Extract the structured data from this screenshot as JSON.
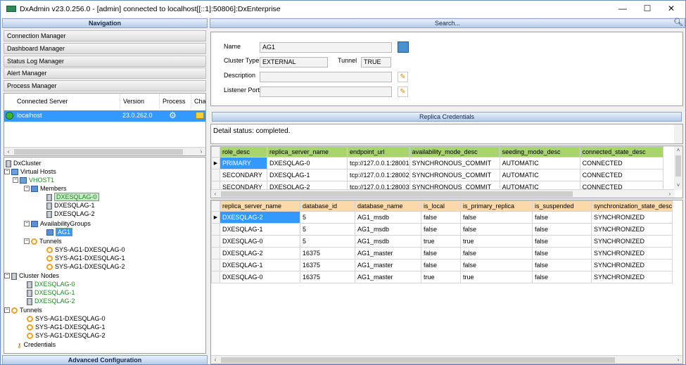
{
  "window": {
    "title": "DxAdmin v23.0.256.0 - [admin] connected to localhost[[::1]:50806]:DxEnterprise",
    "minimize": "—",
    "maximize": "☐",
    "close": "✕"
  },
  "navigation": {
    "header": "Navigation",
    "items": [
      "Connection Manager",
      "Dashboard Manager",
      "Status Log Manager",
      "Alert Manager",
      "Process Manager"
    ],
    "footer": "Advanced Configuration"
  },
  "servers": {
    "columns": [
      "Connected Server",
      "Version",
      "Process",
      "Chat"
    ],
    "rows": [
      {
        "server": "localhost",
        "version": "23.0.262.0"
      }
    ]
  },
  "tree": {
    "root": "DxCluster",
    "virtual_hosts": "Virtual Hosts",
    "vhost": "VHOST1",
    "members": "Members",
    "member_items": [
      "DXESQLAG-0",
      "DXESQLAG-1",
      "DXESQLAG-2"
    ],
    "availability_groups": "AvailabilityGroups",
    "ag": "AG1",
    "tunnels": "Tunnels",
    "tunnel_items": [
      "SYS-AG1-DXESQLAG-0",
      "SYS-AG1-DXESQLAG-1",
      "SYS-AG1-DXESQLAG-2"
    ],
    "cluster_nodes": "Cluster Nodes",
    "node_items": [
      "DXESQLAG-0",
      "DXESQLAG-1",
      "DXESQLAG-2"
    ],
    "tunnels2": "Tunnels",
    "tunnel2_items": [
      "SYS-AG1-DXESQLAG-0",
      "SYS-AG1-DXESQLAG-1",
      "SYS-AG1-DXESQLAG-2"
    ],
    "credentials": "Credentials"
  },
  "search": {
    "label": "Search..."
  },
  "details": {
    "name_label": "Name",
    "name_value": "AG1",
    "cluster_type_label": "Cluster Type",
    "cluster_type_value": "EXTERNAL",
    "tunnel_label": "Tunnel",
    "tunnel_value": "TRUE",
    "description_label": "Description",
    "description_value": "",
    "listener_label": "Listener Port",
    "listener_value": ""
  },
  "replica": {
    "header": "Replica Credentials",
    "status": "Detail status: completed."
  },
  "grid1": {
    "columns": [
      "role_desc",
      "replica_server_name",
      "endpoint_url",
      "availability_mode_desc",
      "seeding_mode_desc",
      "connected_state_desc"
    ],
    "rows": [
      [
        "PRIMARY",
        "DXESQLAG-0",
        "tcp://127.0.0.1:28001",
        "SYNCHRONOUS_COMMIT",
        "AUTOMATIC",
        "CONNECTED"
      ],
      [
        "SECONDARY",
        "DXESQLAG-1",
        "tcp://127.0.0.1:28002",
        "SYNCHRONOUS_COMMIT",
        "AUTOMATIC",
        "CONNECTED"
      ],
      [
        "SECONDARY",
        "DXESQLAG-2",
        "tcp://127.0.0.1:28003",
        "SYNCHRONOUS_COMMIT",
        "AUTOMATIC",
        "CONNECTED"
      ]
    ]
  },
  "grid2": {
    "columns": [
      "replica_server_name",
      "database_id",
      "database_name",
      "is_local",
      "is_primary_replica",
      "is_suspended",
      "synchronization_state_desc"
    ],
    "rows": [
      [
        "DXESQLAG-2",
        "5",
        "AG1_msdb",
        "false",
        "false",
        "false",
        "SYNCHRONIZED"
      ],
      [
        "DXESQLAG-1",
        "5",
        "AG1_msdb",
        "false",
        "false",
        "false",
        "SYNCHRONIZED"
      ],
      [
        "DXESQLAG-0",
        "5",
        "AG1_msdb",
        "true",
        "true",
        "false",
        "SYNCHRONIZED"
      ],
      [
        "DXESQLAG-2",
        "16375",
        "AG1_master",
        "false",
        "false",
        "false",
        "SYNCHRONIZED"
      ],
      [
        "DXESQLAG-1",
        "16375",
        "AG1_master",
        "false",
        "false",
        "false",
        "SYNCHRONIZED"
      ],
      [
        "DXESQLAG-0",
        "16375",
        "AG1_master",
        "true",
        "true",
        "false",
        "SYNCHRONIZED"
      ]
    ]
  },
  "colors": {
    "selection": "#3399ff",
    "grid1_header": "#a8d46c",
    "grid2_header": "#fbd9ab",
    "node_green": "#1f8a1f"
  }
}
